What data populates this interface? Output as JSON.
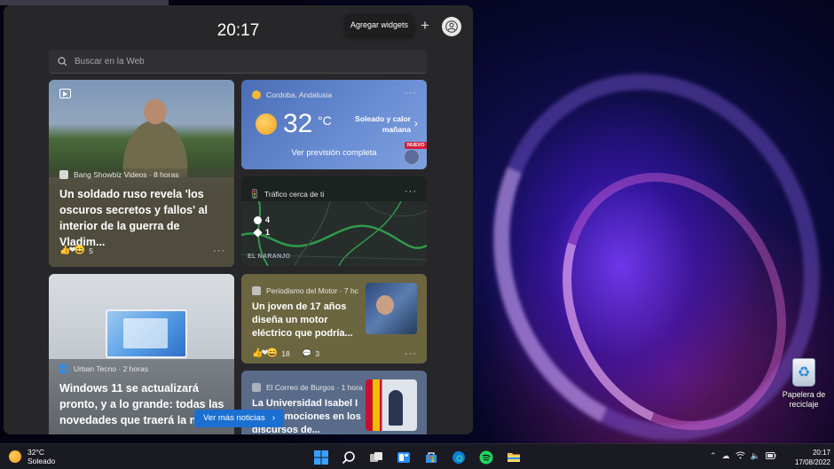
{
  "widgets": {
    "clock": "20:17",
    "add_widgets_label": "Agregar widgets",
    "plus_symbol": "+",
    "search_placeholder": "Buscar en la Web",
    "see_more_news": "Ver más noticias"
  },
  "cards": {
    "soldier": {
      "source": "Bang Showbiz Videos · 8 horas",
      "headline": "Un soldado ruso revela 'los oscuros secretos y fallos' al interior de la guerra de Vladim...",
      "reaction_count": "5",
      "more": "···"
    },
    "weather": {
      "location": "Cordoba, Andalusia",
      "temperature": "32",
      "unit": "°C",
      "condition": "Soleado y calor mañana",
      "forecast_link": "Ver previsión completa",
      "badge": "NUEVO",
      "more": "···"
    },
    "traffic": {
      "title": "Tráfico cerca de ti",
      "stat_1": "4",
      "stat_2": "1",
      "place": "EL NARANJO",
      "more": "···"
    },
    "motor": {
      "source": "Periodismo del Motor · 7 hc",
      "headline": "Un joven de 17 años diseña un motor eléctrico que podría...",
      "reaction_count": "18",
      "comment_count": "3",
      "more": "···"
    },
    "windows": {
      "source": "Urban Tecno · 2 horas",
      "headline": "Windows 11 se actualizará pronto, y a lo grande: todas las novedades que traerá la nu..."
    },
    "correo": {
      "source": "El Correo de Burgos · 1 hora",
      "headline": "La Universidad Isabel I ... las emociones en los discursos de..."
    }
  },
  "desktop": {
    "recycle_bin_label": "Papelera de reciclaje"
  },
  "taskbar": {
    "weather_temp": "32°C",
    "weather_condition": "Soleado",
    "time": "20:17",
    "date": "17/08/2022",
    "pinned": [
      "windows-start",
      "search",
      "task-view",
      "widgets",
      "microsoft-store",
      "edge",
      "spotify",
      "file-explorer"
    ]
  },
  "colors": {
    "accent": "#1b6fd0",
    "panel": "#272729",
    "nuevo_badge": "#d21f3c",
    "spotify": "#1ed760"
  }
}
